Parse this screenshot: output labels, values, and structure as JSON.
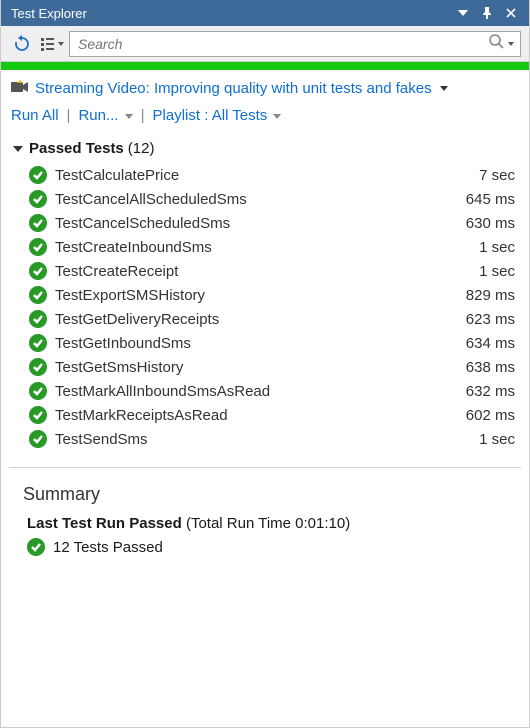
{
  "titlebar": {
    "title": "Test Explorer"
  },
  "toolbar": {
    "search_placeholder": "Search"
  },
  "info_link": "Streaming Video: Improving quality with unit tests and fakes",
  "actions": {
    "run_all": "Run All",
    "run": "Run...",
    "playlist_label": "Playlist : All Tests"
  },
  "group": {
    "label": "Passed Tests",
    "count": "(12)"
  },
  "tests": [
    {
      "name": "TestCalculatePrice",
      "time": "7 sec"
    },
    {
      "name": "TestCancelAllScheduledSms",
      "time": "645 ms"
    },
    {
      "name": "TestCancelScheduledSms",
      "time": "630 ms"
    },
    {
      "name": "TestCreateInboundSms",
      "time": "1 sec"
    },
    {
      "name": "TestCreateReceipt",
      "time": "1 sec"
    },
    {
      "name": "TestExportSMSHistory",
      "time": "829 ms"
    },
    {
      "name": "TestGetDeliveryReceipts",
      "time": "623 ms"
    },
    {
      "name": "TestGetInboundSms",
      "time": "634 ms"
    },
    {
      "name": "TestGetSmsHistory",
      "time": "638 ms"
    },
    {
      "name": "TestMarkAllInboundSmsAsRead",
      "time": "632 ms"
    },
    {
      "name": "TestMarkReceiptsAsRead",
      "time": "602 ms"
    },
    {
      "name": "TestSendSms",
      "time": "1 sec"
    }
  ],
  "summary": {
    "heading": "Summary",
    "line1_bold": "Last Test Run Passed",
    "line1_rest": " (Total Run Time 0:01:10)",
    "line2": "12 Tests Passed"
  }
}
